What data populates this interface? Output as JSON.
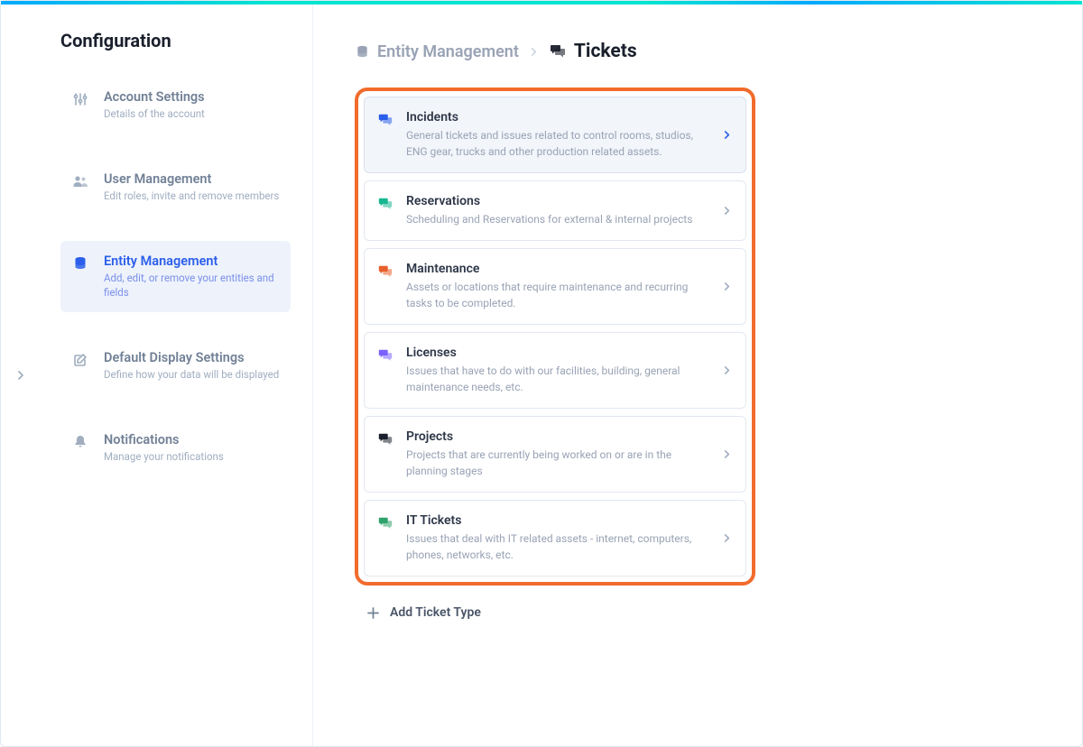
{
  "sidebar": {
    "title": "Configuration",
    "items": [
      {
        "label": "Account Settings",
        "sub": "Details of the account"
      },
      {
        "label": "User Management",
        "sub": "Edit roles, invite and remove members"
      },
      {
        "label": "Entity Management",
        "sub": "Add, edit, or remove your entities and fields"
      },
      {
        "label": "Default Display Settings",
        "sub": "Define how your data will be displayed"
      },
      {
        "label": "Notifications",
        "sub": "Manage your notifications"
      }
    ]
  },
  "breadcrumb": {
    "parent": "Entity Management",
    "current": "Tickets"
  },
  "tickets": [
    {
      "title": "Incidents",
      "desc": "General tickets and issues related to control rooms, studios, ENG gear, trucks and other production related assets.",
      "color": "#2b5fea"
    },
    {
      "title": "Reservations",
      "desc": "Scheduling and Reservations for external & internal projects",
      "color": "#17b890"
    },
    {
      "title": "Maintenance",
      "desc": "Assets or locations that require maintenance and recurring tasks to be completed.",
      "color": "#e8602c"
    },
    {
      "title": "Licenses",
      "desc": "Issues that have to do with our facilities, building, general maintenance needs, etc.",
      "color": "#7b61ff"
    },
    {
      "title": "Projects",
      "desc": "Projects that are currently being worked on or are in the planning stages",
      "color": "#1a202c"
    },
    {
      "title": "IT Tickets",
      "desc": "Issues that deal with IT related assets - internet, computers, phones, networks, etc.",
      "color": "#2fa36b"
    }
  ],
  "add_label": "Add Ticket Type"
}
